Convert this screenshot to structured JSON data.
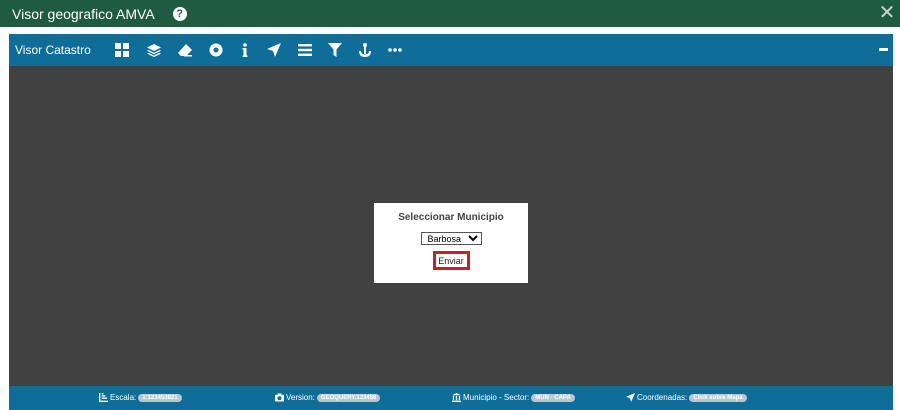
{
  "app": {
    "title": "Visor geografico AMVA",
    "help": "?",
    "close": "✕"
  },
  "viewer": {
    "title": "Visor Catastro"
  },
  "toolbar": {
    "icons": [
      "grid-icon",
      "layers-icon",
      "eraser-icon",
      "record-icon",
      "info-icon",
      "location-arrow-icon",
      "list-icon",
      "filter-icon",
      "anchor-icon",
      "more-icon"
    ]
  },
  "dialog": {
    "title": "Seleccionar Municipio",
    "selected_municipio": "Barbosa",
    "submit_label": "Enviar"
  },
  "status": {
    "scale_label": "Escala:",
    "scale_value": "1:123453821",
    "version_label": "Version:",
    "version_value": "GEOQUERY.123456",
    "municipio_label": "Municipio - Sector:",
    "municipio_value": "MUN - CAPA",
    "coords_label": "Coordenadas:",
    "coords_value": "Click sobre Mapa"
  },
  "colors": {
    "header": "#1f5b40",
    "toolbar": "#0e6e99",
    "map": "#414141",
    "highlight": "#d01c24"
  }
}
